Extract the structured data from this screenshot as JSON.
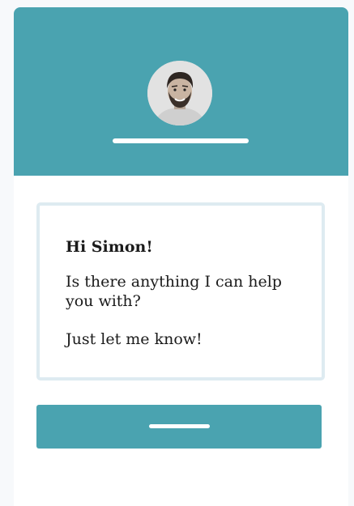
{
  "colors": {
    "accent": "#4aa3b0",
    "card_background": "#ffffff",
    "page_background": "#f7f9fb",
    "message_border": "#deebf1",
    "text": "#1b1b1b"
  },
  "header": {
    "avatar_icon": "user-avatar-photo"
  },
  "message": {
    "greeting": "Hi Simon!",
    "question": "Is there anything I can help you with?",
    "closing": "Just let me know!"
  }
}
